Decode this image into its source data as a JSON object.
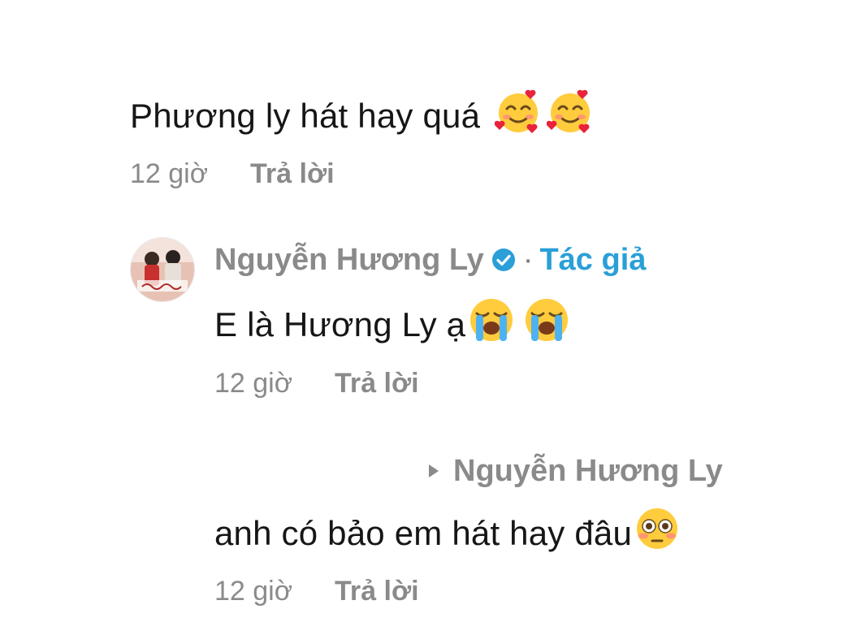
{
  "comments": [
    {
      "text": "Phương ly hát hay quá",
      "emojis": [
        "smiling-face-with-hearts",
        "smiling-face-with-hearts"
      ],
      "time": "12 giờ",
      "reply_label": "Trả lời"
    },
    {
      "author": "Nguyễn Hương Ly",
      "verified": true,
      "separator": "·",
      "author_tag": "Tác giả",
      "text": "E là Hương Ly ạ",
      "emojis": [
        "loudly-crying-face",
        "loudly-crying-face"
      ],
      "time": "12 giờ",
      "reply_label": "Trả lời"
    },
    {
      "reply_to": "Nguyễn Hương Ly",
      "text": "anh có bảo em hát hay đâu",
      "emojis": [
        "flushed-face"
      ],
      "time": "12 giờ",
      "reply_label": "Trả lời"
    }
  ],
  "colors": {
    "text": "#161616",
    "meta": "#8a8a8a",
    "author_tag": "#2a9fd8",
    "verified_badge": "#2a9fd8"
  },
  "icons": {
    "verified": "verified-badge-icon",
    "reply_arrow": "reply-arrow-icon"
  }
}
